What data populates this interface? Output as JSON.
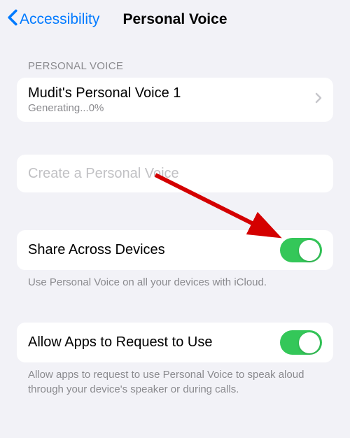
{
  "nav": {
    "back_label": "Accessibility",
    "title": "Personal Voice"
  },
  "section1": {
    "header": "PERSONAL VOICE",
    "voice": {
      "name": "Mudit's Personal Voice 1",
      "status": "Generating...0%"
    }
  },
  "create": {
    "label": "Create a Personal Voice"
  },
  "share": {
    "label": "Share Across Devices",
    "footer": "Use Personal Voice on all your devices with iCloud.",
    "enabled": true
  },
  "allow": {
    "label": "Allow Apps to Request to Use",
    "footer": "Allow apps to request to use Personal Voice to speak aloud through your device's speaker or during calls.",
    "enabled": true
  },
  "annotation": {
    "type": "arrow",
    "color": "#d40000"
  }
}
